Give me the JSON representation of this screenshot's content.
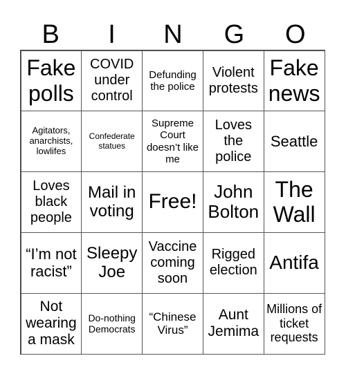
{
  "header": [
    "B",
    "I",
    "N",
    "G",
    "O"
  ],
  "cells": [
    "Fake polls",
    "COVID under control",
    "Defunding the police",
    "Violent protests",
    "Fake news",
    "Agitators, anarchists, lowlifes",
    "Confederate statues",
    "Supreme Court doesn’t like me",
    "Loves the police",
    "Seattle",
    "Loves black people",
    "Mail in voting",
    "Free!",
    "John Bolton",
    "The Wall",
    "“I’m not racist”",
    "Sleepy Joe",
    "Vaccine coming soon",
    "Rigged election",
    "Antifa",
    "Not wearing a mask",
    "Do-nothing Democrats",
    "“Chinese Virus”",
    "Aunt Jemima",
    "Millions of ticket requests"
  ]
}
